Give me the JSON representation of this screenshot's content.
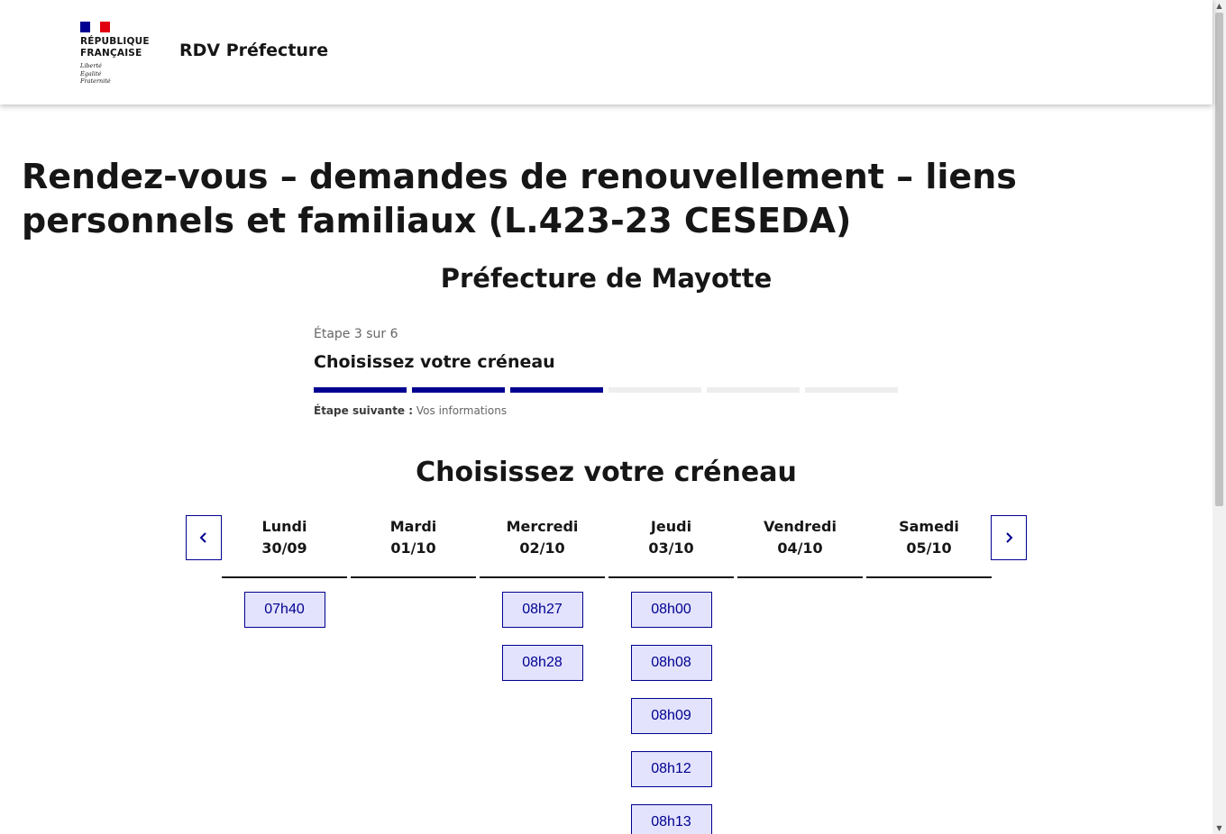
{
  "header": {
    "logo_text": "RÉPUBLIQUE\nFRANÇAISE",
    "logo_motto": "Liberté\nÉgalité\nFraternité",
    "site_title": "RDV Préfecture"
  },
  "page": {
    "title": "Rendez-vous – demandes de renouvellement – liens personnels et familiaux (L.423-23 CESEDA)",
    "prefecture": "Préfecture de Mayotte"
  },
  "stepper": {
    "state": "Étape 3 sur 6",
    "title": "Choisissez votre créneau",
    "current_step": 3,
    "total_steps": 6,
    "next_label": "Étape suivante :",
    "next_value": "Vos informations"
  },
  "slots_section": {
    "title": "Choisissez votre créneau",
    "prev_icon": "chevron-left-icon",
    "next_icon": "chevron-right-icon",
    "days": [
      {
        "name": "Lundi",
        "date": "30/09",
        "slots": [
          "07h40"
        ]
      },
      {
        "name": "Mardi",
        "date": "01/10",
        "slots": []
      },
      {
        "name": "Mercredi",
        "date": "02/10",
        "slots": [
          "08h27",
          "08h28"
        ]
      },
      {
        "name": "Jeudi",
        "date": "03/10",
        "slots": [
          "08h00",
          "08h08",
          "08h09",
          "08h12",
          "08h13"
        ]
      },
      {
        "name": "Vendredi",
        "date": "04/10",
        "slots": []
      },
      {
        "name": "Samedi",
        "date": "05/10",
        "slots": []
      }
    ]
  },
  "colors": {
    "accent": "#000091",
    "slot_bg": "#e3e3fd",
    "flag_red": "#e1000f"
  }
}
